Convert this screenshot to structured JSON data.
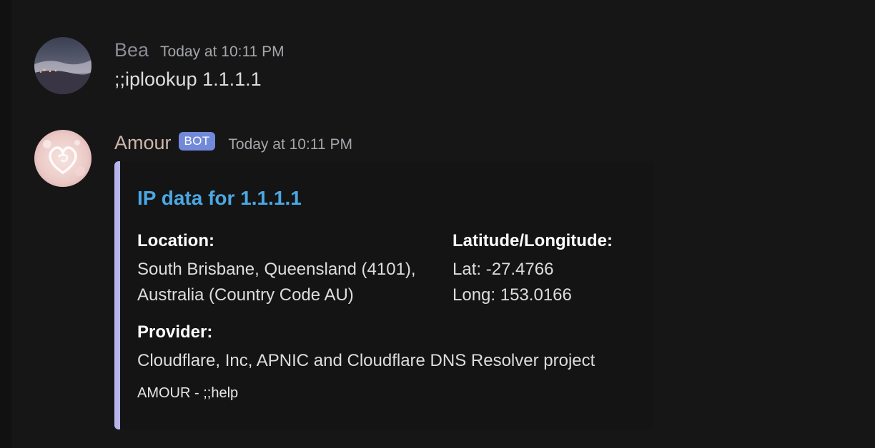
{
  "messages": [
    {
      "username": "Bea",
      "username_color": "#8e8a96",
      "timestamp": "Today at 10:11 PM",
      "content": ";;iplookup 1.1.1.1"
    },
    {
      "username": "Amour",
      "username_color": "#cdb6ab",
      "bot_tag": "BOT",
      "timestamp": "Today at 10:11 PM",
      "embed": {
        "accent_color": "#b8b4ec",
        "title": "IP data for 1.1.1.1",
        "fields": {
          "location": {
            "name": "Location:",
            "value_line1": "South Brisbane, Queensland (4101),",
            "value_line2": "Australia (Country Code AU)"
          },
          "latlong": {
            "name": "Latitude/Longitude:",
            "value_line1": "Lat: -27.4766",
            "value_line2": "Long: 153.0166"
          },
          "provider": {
            "name": "Provider:",
            "value": "Cloudflare, Inc, APNIC and Cloudflare DNS Resolver project"
          }
        },
        "footer": "AMOUR - ;;help"
      }
    }
  ],
  "colors": {
    "background": "#161616",
    "text": "#dcddde",
    "timestamp": "#a3a6aa",
    "bot_tag": "#7289da",
    "embed_title": "#4ba7e3"
  }
}
